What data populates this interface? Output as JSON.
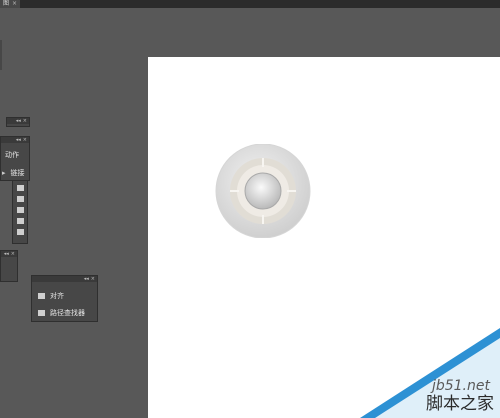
{
  "document_tab": {
    "title": "图",
    "close": "×"
  },
  "panels": {
    "actions_links": {
      "head_collapse": "◂◂",
      "head_close": "×",
      "items": [
        {
          "label": "动作"
        },
        {
          "label": "链接"
        }
      ]
    },
    "align_pathfinder": {
      "head_collapse": "◂◂",
      "head_close": "×",
      "items": [
        {
          "label": "对齐"
        },
        {
          "label": "路径查找器"
        }
      ]
    }
  },
  "watermark": {
    "domain": "jb51.net",
    "brand": "脚本之家"
  },
  "colors": {
    "workspace": "#585858",
    "panel": "#474747",
    "canvas": "#ffffff",
    "watermark_blue": "#2d91d4"
  },
  "icons": [
    "collapse-icon",
    "close-icon",
    "align-icon",
    "pathfinder-icon",
    "tool-icon"
  ]
}
